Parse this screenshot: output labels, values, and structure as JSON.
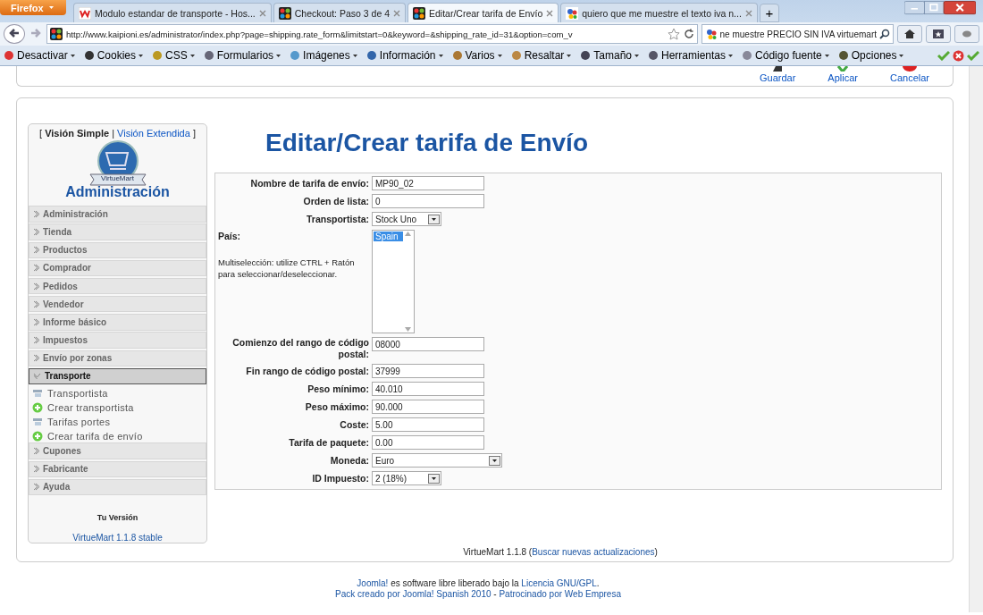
{
  "browser": {
    "menu_button": "Firefox",
    "tabs": [
      {
        "title": "Modulo estandar de transporte - Hos...",
        "selected": false
      },
      {
        "title": "Checkout: Paso 3 de 4",
        "selected": false
      },
      {
        "title": "Editar/Crear tarifa de Envío",
        "selected": true
      },
      {
        "title": "quiero que me muestre el texto iva n...",
        "selected": false
      }
    ],
    "new_tab": "+",
    "url": "http://www.kaipioni.es/administrator/index.php?page=shipping.rate_form&limitstart=0&keyword=&shipping_rate_id=31&option=com_v",
    "search": "ne muestre PRECIO SIN IVA virtuemart",
    "dev_toolbar": [
      "Desactivar",
      "Cookies",
      "CSS",
      "Formularios",
      "Imágenes",
      "Información",
      "Varios",
      "Resaltar",
      "Tamaño",
      "Herramientas",
      "Código fuente",
      "Opciones"
    ]
  },
  "toolbar": [
    {
      "label": "Guardar",
      "kind": "save"
    },
    {
      "label": "Aplicar",
      "kind": "apply"
    },
    {
      "label": "Cancelar",
      "kind": "cancel"
    }
  ],
  "sidebar": {
    "open_bracket": "[",
    "views": [
      {
        "label": "Visión Simple",
        "selected": true
      },
      {
        "label": "Visión Extendida",
        "selected": false
      }
    ],
    "separator": "|",
    "close_bracket": "]",
    "logo_text": "VirtueMart",
    "heading": "Administración",
    "sections": [
      {
        "label": "Administración",
        "expanded": false
      },
      {
        "label": "Tienda",
        "expanded": false
      },
      {
        "label": "Productos",
        "expanded": false
      },
      {
        "label": "Comprador",
        "expanded": false
      },
      {
        "label": "Pedidos",
        "expanded": false
      },
      {
        "label": "Vendedor",
        "expanded": false
      },
      {
        "label": "Informe básico",
        "expanded": false
      },
      {
        "label": "Impuestos",
        "expanded": false
      },
      {
        "label": "Envío por zonas",
        "expanded": false
      },
      {
        "label": "Transporte",
        "expanded": true,
        "children": [
          {
            "label": "Transportista",
            "kind": "list"
          },
          {
            "label": "Crear transportista",
            "kind": "add"
          },
          {
            "label": "Tarifas portes",
            "kind": "list"
          },
          {
            "label": "Crear tarifa de envío",
            "kind": "add"
          }
        ]
      },
      {
        "label": "Cupones",
        "expanded": false
      },
      {
        "label": "Fabricante",
        "expanded": false
      },
      {
        "label": "Ayuda",
        "expanded": false
      }
    ],
    "version_label": "Tu Versión",
    "version": "VirtueMart 1.1.8 stable"
  },
  "page_title": "Editar/Crear tarifa de Envío",
  "form": [
    {
      "label": "Nombre de tarifa de envío:",
      "kind": "text",
      "value": "MP90_02"
    },
    {
      "label": "Orden de lista:",
      "kind": "text",
      "value": "0"
    },
    {
      "label": "Transportista:",
      "kind": "select",
      "value": "Stock Uno"
    },
    {
      "label": "País:",
      "kind": "multiselect",
      "note": "Multiselección: utilize CTRL + Ratón para seleccionar/deseleccionar.",
      "options": [
        {
          "label": "Spain",
          "selected": true
        }
      ]
    },
    {
      "label": "Comienzo del rango de código postal:",
      "kind": "text",
      "value": "08000"
    },
    {
      "label": "Fin rango de código postal:",
      "kind": "text",
      "value": "37999"
    },
    {
      "label": "Peso mínimo:",
      "kind": "text",
      "value": "40.010"
    },
    {
      "label": "Peso máximo:",
      "kind": "text",
      "value": "90.000"
    },
    {
      "label": "Coste:",
      "kind": "text",
      "value": "5.00"
    },
    {
      "label": "Tarifa de paquete:",
      "kind": "text",
      "value": "0.00"
    },
    {
      "label": "Moneda:",
      "kind": "wide_select",
      "value": "Euro"
    },
    {
      "label": "ID Impuesto:",
      "kind": "select",
      "value": "2 (18%)"
    }
  ],
  "version_line": {
    "before": "VirtueMart 1.1.8 (",
    "link": "Buscar nuevas actualizaciones",
    "after": ")"
  },
  "footer": {
    "joomla_link": "Joomla!",
    "license_text": " es software libre liberado bajo la ",
    "license_link": "Licencia GNU/GPL",
    "end": ".",
    "pack_link": "Pack creado por Joomla! Spanish 2010",
    "dash": " - ",
    "sponsor_link": "Patrocinado por Web Empresa"
  }
}
